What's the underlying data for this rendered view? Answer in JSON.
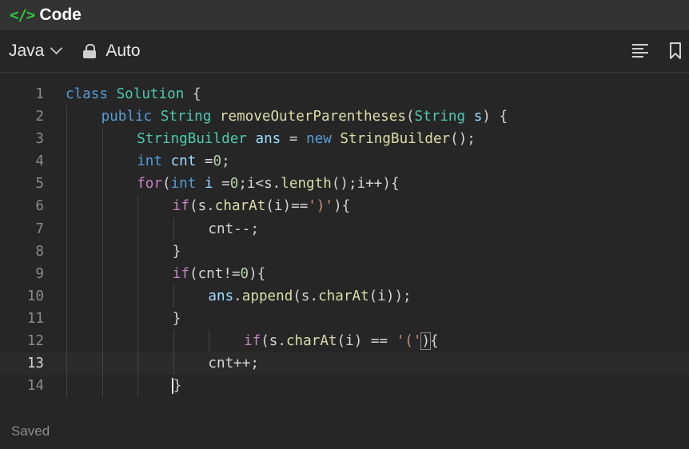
{
  "header": {
    "title": "Code",
    "icon": "code-icon"
  },
  "toolbar": {
    "language": "Java",
    "mode": "Auto"
  },
  "editor": {
    "current_line": 13,
    "line_numbers": [
      "1",
      "2",
      "3",
      "4",
      "5",
      "6",
      "7",
      "8",
      "9",
      "10",
      "11",
      "12",
      "13",
      "14"
    ],
    "lines": [
      [
        [
          "k",
          "class "
        ],
        [
          "t",
          "Solution"
        ],
        [
          "p",
          " {"
        ]
      ],
      [
        [
          "k",
          "public "
        ],
        [
          "t",
          "String "
        ],
        [
          "f",
          "removeOuterParentheses"
        ],
        [
          "p",
          "("
        ],
        [
          "t",
          "String "
        ],
        [
          "v",
          "s"
        ],
        [
          "p",
          ") {"
        ]
      ],
      [
        [
          "t",
          "StringBuilder "
        ],
        [
          "v",
          "ans"
        ],
        [
          "p",
          " = "
        ],
        [
          "k",
          "new "
        ],
        [
          "f",
          "StringBuilder"
        ],
        [
          "p",
          "();"
        ]
      ],
      [
        [
          "k",
          "int "
        ],
        [
          "v",
          "cnt"
        ],
        [
          "p",
          " ="
        ],
        [
          "n",
          "0"
        ],
        [
          "p",
          ";"
        ]
      ],
      [
        [
          "kc",
          "for"
        ],
        [
          "p",
          "("
        ],
        [
          "k",
          "int "
        ],
        [
          "v",
          "i"
        ],
        [
          "p",
          " ="
        ],
        [
          "n",
          "0"
        ],
        [
          "p",
          ";i<s."
        ],
        [
          "f",
          "length"
        ],
        [
          "p",
          "();i++){"
        ]
      ],
      [
        [
          "kc",
          "if"
        ],
        [
          "p",
          "(s."
        ],
        [
          "f",
          "charAt"
        ],
        [
          "p",
          "(i)=="
        ],
        [
          "s",
          "')'"
        ],
        [
          "p",
          "){"
        ]
      ],
      [
        [
          "p",
          "cnt--;"
        ]
      ],
      [
        [
          "p",
          "}"
        ]
      ],
      [
        [
          "kc",
          "if"
        ],
        [
          "p",
          "(cnt!="
        ],
        [
          "n",
          "0"
        ],
        [
          "p",
          "){"
        ]
      ],
      [
        [
          "v",
          "ans"
        ],
        [
          "p",
          "."
        ],
        [
          "f",
          "append"
        ],
        [
          "p",
          "(s."
        ],
        [
          "f",
          "charAt"
        ],
        [
          "p",
          "(i));"
        ]
      ],
      [
        [
          "p",
          "}"
        ]
      ],
      [
        [
          "kc",
          "if"
        ],
        [
          "p",
          "(s."
        ],
        [
          "f",
          "charAt"
        ],
        [
          "p",
          "(i) == "
        ],
        [
          "s",
          "'('"
        ],
        [
          "bb",
          "){"
        ]
      ],
      [
        [
          "p",
          "cnt++;"
        ]
      ],
      [
        [
          "bc",
          "}"
        ]
      ]
    ]
  },
  "status": {
    "text": "Saved"
  },
  "colors": {
    "bg": "#262626",
    "header_bg": "#333333",
    "accent_green": "#2ecc40"
  }
}
